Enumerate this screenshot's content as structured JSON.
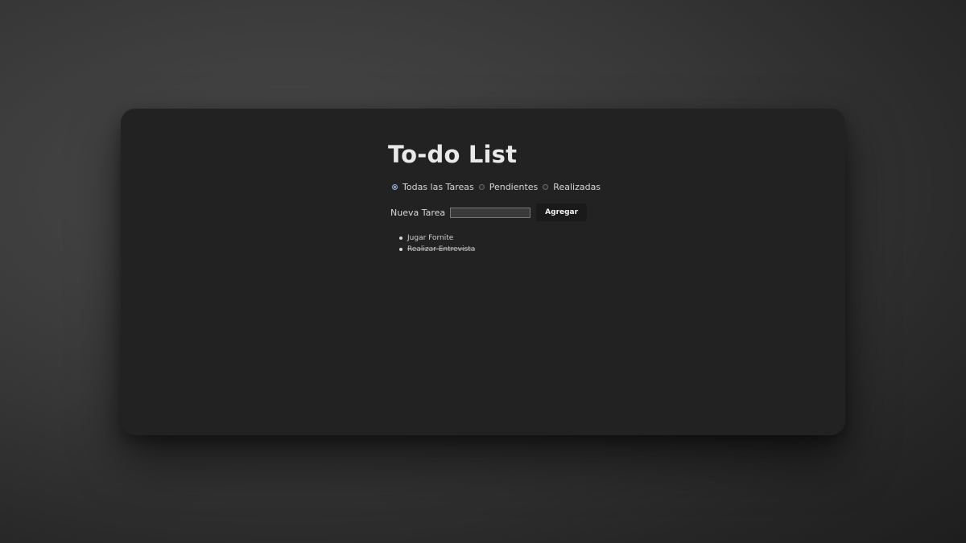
{
  "app": {
    "title": "To-do List"
  },
  "filters": {
    "options": [
      {
        "label": "Todas las Tareas",
        "checked": true
      },
      {
        "label": "Pendientes",
        "checked": false
      },
      {
        "label": "Realizadas",
        "checked": false
      }
    ]
  },
  "new_task": {
    "label": "Nueva Tarea",
    "value": "",
    "placeholder": "",
    "button_label": "Agregar"
  },
  "tasks": [
    {
      "text": "Jugar Fornite",
      "done": false
    },
    {
      "text": "Realizar Entrevista",
      "done": true
    }
  ],
  "colors": {
    "window_bg": "#222222",
    "radio_accent": "#8ab4e8",
    "button_bg": "#1a1a1a"
  }
}
